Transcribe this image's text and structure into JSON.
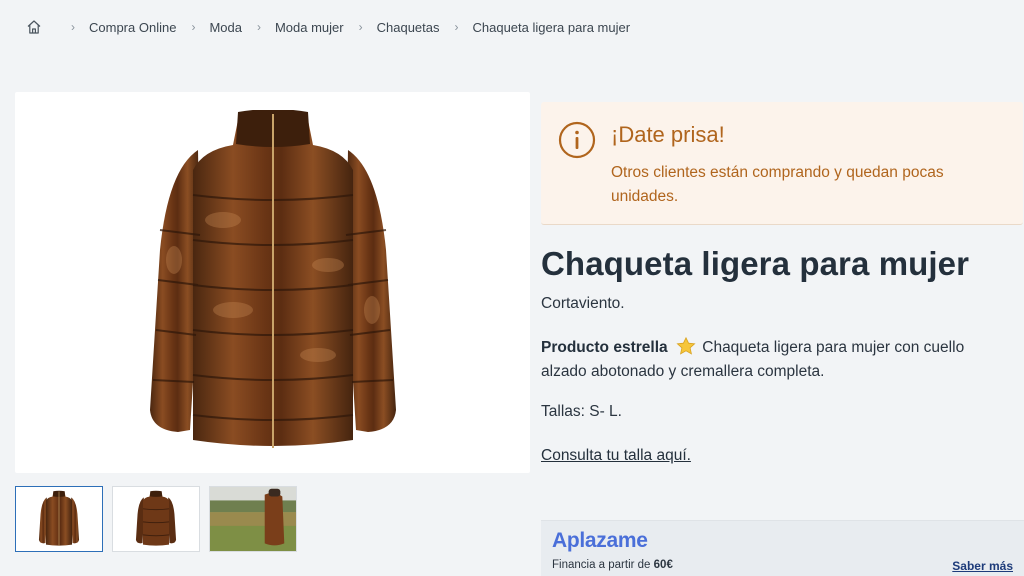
{
  "breadcrumb": {
    "home_icon": "home-icon",
    "items": [
      "Compra Online",
      "Moda",
      "Moda mujer",
      "Chaquetas",
      "Chaqueta ligera para mujer"
    ]
  },
  "notice": {
    "icon": "info-icon",
    "title": "¡Date prisa!",
    "text": "Otros clientes están comprando y quedan pocas unidades.",
    "color": "#b0651d",
    "background": "#fcf3eb"
  },
  "product": {
    "title": "Chaqueta ligera para mujer",
    "subtitle": "Cortaviento.",
    "highlight_label": "Producto estrella",
    "highlight_icon": "star-icon",
    "description": "Chaqueta ligera para mujer con cuello alzado abotonado y cremallera completa.",
    "sizes": "Tallas: S- L.",
    "size_guide_link": "Consulta tu talla aquí."
  },
  "gallery": {
    "main_image": "bronze puffer jacket front view",
    "thumbnails": [
      "jacket front view",
      "jacket back view",
      "jacket worn outdoors"
    ],
    "selected_index": 0
  },
  "aplazame": {
    "logo": "Aplazame",
    "financing_text": "Financia a partir de",
    "financing_amount": "60€",
    "more_link": "Saber más",
    "brand_color": "#4a6fd9"
  }
}
